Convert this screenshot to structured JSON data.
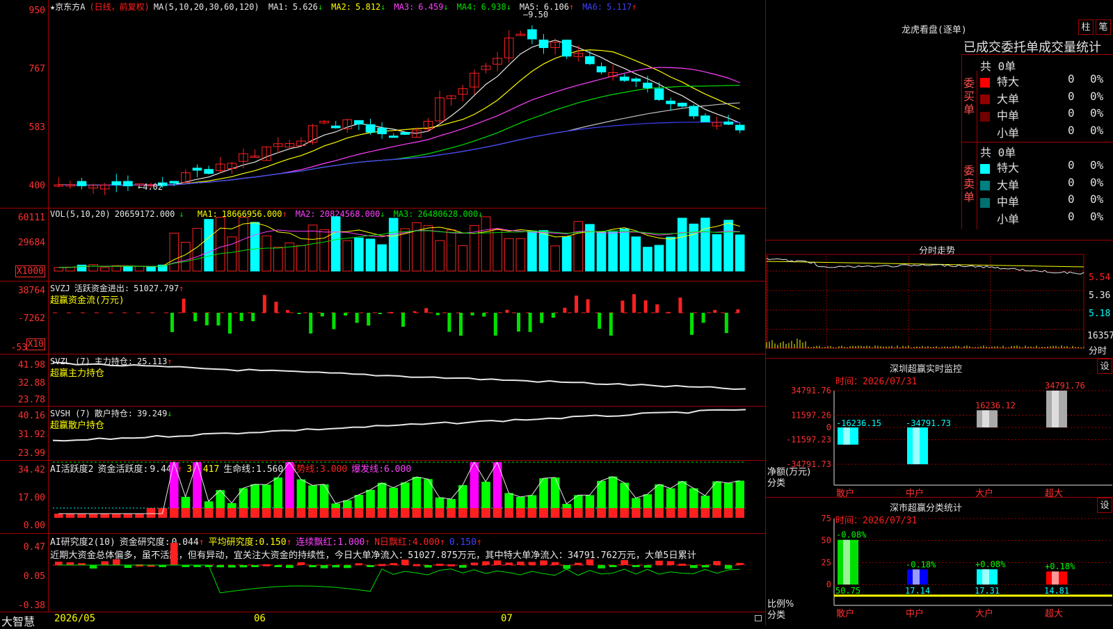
{
  "app": {
    "brand": "大智慧"
  },
  "kline": {
    "title": "★京东方A",
    "mode": "(日线，前复权)",
    "ma_params": "MA(5,10,20,30,60,120)",
    "ma": [
      {
        "label": "MA1:",
        "value": "5.626",
        "arrow": "↓",
        "color": "#e8e8e8"
      },
      {
        "label": "MA2:",
        "value": "5.812",
        "arrow": "↓",
        "color": "#ffff00"
      },
      {
        "label": "MA3:",
        "value": "6.459",
        "arrow": "↓",
        "color": "#ff40ff"
      },
      {
        "label": "MA4:",
        "value": "6.938",
        "arrow": "↓",
        "color": "#00e000"
      },
      {
        "label": "MA5:",
        "value": "6.106",
        "arrow": "↑",
        "color": "#e8e8e8"
      },
      {
        "label": "MA6:",
        "value": "5.117",
        "arrow": "↑",
        "color": "#4040ff"
      }
    ],
    "yticks": [
      "950",
      "767",
      "583",
      "400"
    ],
    "high_label": "9.50",
    "low_label": "4.02",
    "dates": [
      "2026/05",
      "06",
      "07"
    ]
  },
  "vol": {
    "header": "VOL(5,10,20)",
    "value": "20659172.000",
    "value_arrow": "↓",
    "ma": [
      {
        "label": "MA1:",
        "value": "18666956.000",
        "arrow": "↑",
        "color": "#ffff00"
      },
      {
        "label": "MA2:",
        "value": "20824568.000",
        "arrow": "↓",
        "color": "#ff40ff"
      },
      {
        "label": "MA3:",
        "value": "26480628.000",
        "arrow": "↓",
        "color": "#00e000"
      }
    ],
    "yticks": [
      "60111",
      "29684"
    ],
    "unit": "X1000"
  },
  "svzj": {
    "header": "SVZJ",
    "label": "活跃资金进出:",
    "value": "51027.797",
    "arrow": "↑",
    "subtitle": "超赢资金流(万元)",
    "yticks": [
      "38764",
      "-7262",
      "-53"
    ],
    "unit": "X10"
  },
  "svzl": {
    "header": "SVZL (7)",
    "label": "主力持仓:",
    "value": "25.113",
    "arrow": "↑",
    "subtitle": "超赢主力持仓",
    "yticks": [
      "41.98",
      "32.88",
      "23.78"
    ]
  },
  "svsh": {
    "header": "SVSH (7)",
    "label": "散户持仓:",
    "value": "39.249",
    "arrow": "↓",
    "subtitle": "超赢散户持仓",
    "yticks": [
      "40.16",
      "31.92",
      "23.99"
    ]
  },
  "ai_active": {
    "header": "AI活跃度2",
    "label": "资金活跃度:",
    "value": "9.445",
    "arrow": "↑",
    "v2": "34.417",
    "lifeline_label": "生命线:",
    "lifeline": "1.560",
    "strong_label": "强势线:",
    "strong": "3.000",
    "burst_label": "爆发线:",
    "burst": "6.000",
    "yticks": [
      "34.42",
      "17.00",
      "0.00"
    ]
  },
  "ai_research": {
    "header": "AI研究度2(10)",
    "label": "资金研究度:",
    "value": "0.044",
    "arrow": "↑",
    "avg_label": "平均研究度:",
    "avg": "0.150",
    "lianxu_label": "连续飘红:",
    "lianxu": "1.000",
    "nday_label": "N日飘红:",
    "nday": "4.000",
    "extra": "0.150",
    "comment": "近期大资金总体偏多，虽不活跃，但有异动，宜关注大资金的持续性，今日大单净流入：51027.875万元，其中特大单净流入：34791.762万元，大单5日累计",
    "yticks": [
      "0.47",
      "0.05",
      "-0.38"
    ]
  },
  "lhb": {
    "title": "龙虎看盘(逐单)",
    "btn1": "柱",
    "btn2": "笔",
    "subtitle": "已成交委托单成交量统计",
    "buy_label": "委买单",
    "sell_label": "委卖单",
    "buy_total": "共 0单",
    "sell_total": "共 0单",
    "buy_rows": [
      {
        "name": "特大",
        "count": "0",
        "pct": "0%",
        "color": "#ff0000"
      },
      {
        "name": "大单",
        "count": "0",
        "pct": "0%",
        "color": "#900000"
      },
      {
        "name": "中单",
        "count": "0",
        "pct": "0%",
        "color": "#700000"
      },
      {
        "name": "小单",
        "count": "0",
        "pct": "0%",
        "color": ""
      }
    ],
    "sell_rows": [
      {
        "name": "特大",
        "count": "0",
        "pct": "0%",
        "color": "#00ffff"
      },
      {
        "name": "大单",
        "count": "0",
        "pct": "0%",
        "color": "#008080"
      },
      {
        "name": "中单",
        "count": "0",
        "pct": "0%",
        "color": "#007070"
      },
      {
        "name": "小单",
        "count": "0",
        "pct": "0%",
        "color": ""
      }
    ]
  },
  "intraday": {
    "title": "分时走势",
    "yticks": [
      "5.54",
      "5.36",
      "5.18"
    ],
    "vol_label": "16357",
    "bottom_label": "分时"
  },
  "sz_monitor": {
    "title": "深圳超赢实时监控",
    "btn": "设",
    "time_label": "时间：",
    "time": "2026/07/31",
    "yticks": [
      "34791.76",
      "11597.26",
      "0",
      "-11597.23",
      "-34791.73"
    ],
    "ylabel": "净额(万元)",
    "xlabel": "分类",
    "categories": [
      "散户",
      "中户",
      "大户",
      "超大"
    ],
    "values": [
      -16236.15,
      -34791.73,
      16236.12,
      34791.76
    ],
    "value_labels": [
      "-16236.15",
      "-34791.73",
      "16236.12",
      "34791.76"
    ]
  },
  "sz_classify": {
    "title": "深市超赢分类统计",
    "btn": "设",
    "time_label": "时间：",
    "time": "2026/07/31",
    "yticks": [
      "75",
      "50",
      "25",
      "0"
    ],
    "ylabel": "比例%",
    "xlabel": "分类",
    "categories": [
      "散户",
      "中户",
      "大户",
      "超大"
    ],
    "values": [
      50.75,
      17.14,
      17.31,
      14.81
    ],
    "change_labels": [
      "-0.08%",
      "-0.18%",
      "+0.08%",
      "+0.18%"
    ]
  }
}
